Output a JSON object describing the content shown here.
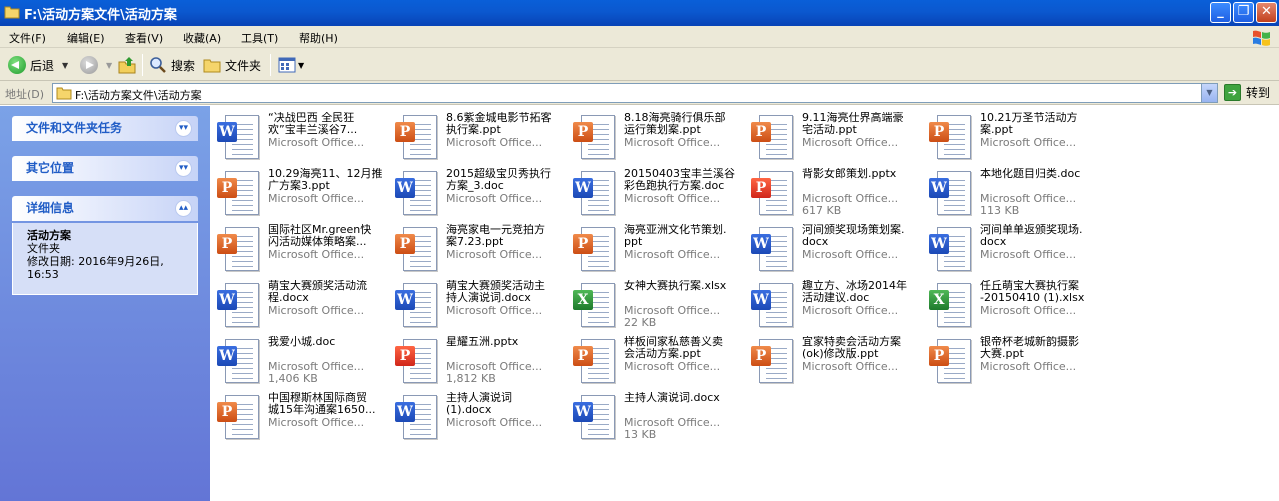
{
  "window": {
    "title": "F:\\活动方案文件\\活动方案"
  },
  "menu": [
    "文件(F)",
    "编辑(E)",
    "查看(V)",
    "收藏(A)",
    "工具(T)",
    "帮助(H)"
  ],
  "toolbar": {
    "back": "后退",
    "search": "搜索",
    "folders": "文件夹"
  },
  "address": {
    "label": "地址(D)",
    "path": "F:\\活动方案文件\\活动方案",
    "go": "转到"
  },
  "sidebar": {
    "tasks_title": "文件和文件夹任务",
    "other_title": "其它位置",
    "details_title": "详细信息",
    "details_name": "活动方案",
    "details_type": "文件夹",
    "details_modified": "修改日期: 2016年9月26日,",
    "details_time": "16:53"
  },
  "files": [
    {
      "name": "“决战巴西 全民狂\n欢”宝丰兰溪谷7...",
      "meta1": "Microsoft Office...",
      "meta2": "",
      "icon": "word-doc-icon",
      "kind": "word"
    },
    {
      "name": "8.6紫金城电影节拓客\n执行案.ppt",
      "meta1": "Microsoft Office...",
      "meta2": "",
      "icon": "ppt-icon",
      "kind": "ppt"
    },
    {
      "name": "8.18海亮骑行俱乐部\n运行策划案.ppt",
      "meta1": "Microsoft Office...",
      "meta2": "",
      "icon": "ppt-icon",
      "kind": "ppt"
    },
    {
      "name": "9.11海亮仕界高端豪\n宅活动.ppt",
      "meta1": "Microsoft Office...",
      "meta2": "",
      "icon": "ppt-icon",
      "kind": "ppt"
    },
    {
      "name": "10.21万圣节活动方\n案.ppt",
      "meta1": "Microsoft Office...",
      "meta2": "",
      "icon": "ppt-icon",
      "kind": "ppt"
    },
    {
      "name": "10.29海亮11、12月推\n广方案3.ppt",
      "meta1": "Microsoft Office...",
      "meta2": "",
      "icon": "ppt-icon",
      "kind": "ppt"
    },
    {
      "name": "2015超级宝贝秀执行\n方案_3.doc",
      "meta1": "Microsoft Office...",
      "meta2": "",
      "icon": "word-doc-icon",
      "kind": "word"
    },
    {
      "name": "20150403宝丰兰溪谷\n彩色跑执行方案.doc",
      "meta1": "Microsoft Office...",
      "meta2": "",
      "icon": "word-doc-icon",
      "kind": "word"
    },
    {
      "name": "背影女郎策划.pptx",
      "meta1": "Microsoft Office...",
      "meta2": "617 KB",
      "icon": "pptx-icon",
      "kind": "pptx"
    },
    {
      "name": "本地化题目归类.doc",
      "meta1": "Microsoft Office...",
      "meta2": "113 KB",
      "icon": "word-doc-icon",
      "kind": "word"
    },
    {
      "name": "国际社区Mr.green快\n闪活动媒体策略案...",
      "meta1": "Microsoft Office...",
      "meta2": "",
      "icon": "ppt-icon",
      "kind": "ppt"
    },
    {
      "name": "海亮家电一元竞拍方\n案7.23.ppt",
      "meta1": "Microsoft Office...",
      "meta2": "",
      "icon": "ppt-icon",
      "kind": "ppt"
    },
    {
      "name": "海亮亚洲文化节策划.\nppt",
      "meta1": "Microsoft Office...",
      "meta2": "",
      "icon": "ppt-icon",
      "kind": "ppt"
    },
    {
      "name": "河间颁奖现场策划案.\ndocx",
      "meta1": "Microsoft Office...",
      "meta2": "",
      "icon": "word-docx-icon",
      "kind": "docx"
    },
    {
      "name": "河间单单返颁奖现场.\ndocx",
      "meta1": "Microsoft Office...",
      "meta2": "",
      "icon": "word-docx-icon",
      "kind": "docx"
    },
    {
      "name": "萌宝大赛颁奖活动流\n程.docx",
      "meta1": "Microsoft Office...",
      "meta2": "",
      "icon": "word-docx-icon",
      "kind": "docx"
    },
    {
      "name": "萌宝大赛颁奖活动主\n持人演说词.docx",
      "meta1": "Microsoft Office...",
      "meta2": "",
      "icon": "word-docx-icon",
      "kind": "docx"
    },
    {
      "name": "女神大赛执行案.xlsx",
      "meta1": "Microsoft Office...",
      "meta2": "22 KB",
      "icon": "excel-icon",
      "kind": "xls"
    },
    {
      "name": "趣立方、冰场2014年\n活动建议.doc",
      "meta1": "Microsoft Office...",
      "meta2": "",
      "icon": "word-doc-icon",
      "kind": "word"
    },
    {
      "name": "任丘萌宝大赛执行案\n-20150410 (1).xlsx",
      "meta1": "Microsoft Office...",
      "meta2": "",
      "icon": "excel-icon",
      "kind": "xls"
    },
    {
      "name": "我爱小城.doc",
      "meta1": "Microsoft Office...",
      "meta2": "1,406 KB",
      "icon": "word-doc-icon",
      "kind": "word"
    },
    {
      "name": "星耀五洲.pptx",
      "meta1": "Microsoft Office...",
      "meta2": "1,812 KB",
      "icon": "pptx-icon",
      "kind": "pptx"
    },
    {
      "name": "样板间家私慈善义卖\n会活动方案.ppt",
      "meta1": "Microsoft Office...",
      "meta2": "",
      "icon": "ppt-icon",
      "kind": "ppt"
    },
    {
      "name": "宜家特卖会活动方案\n(ok)修改版.ppt",
      "meta1": "Microsoft Office...",
      "meta2": "",
      "icon": "ppt-icon",
      "kind": "ppt"
    },
    {
      "name": "银帝杯老城新韵摄影\n大赛.ppt",
      "meta1": "Microsoft Office...",
      "meta2": "",
      "icon": "ppt-icon",
      "kind": "ppt"
    },
    {
      "name": "中国穆斯林国际商贸\n城15年沟通案1650...",
      "meta1": "Microsoft Office...",
      "meta2": "",
      "icon": "ppt-icon",
      "kind": "ppt"
    },
    {
      "name": "主持人演说词\n(1).docx",
      "meta1": "Microsoft Office...",
      "meta2": "",
      "icon": "word-docx-icon",
      "kind": "docx"
    },
    {
      "name": "主持人演说词.docx",
      "meta1": "Microsoft Office...",
      "meta2": "13 KB",
      "icon": "word-docx-icon",
      "kind": "docx"
    }
  ]
}
